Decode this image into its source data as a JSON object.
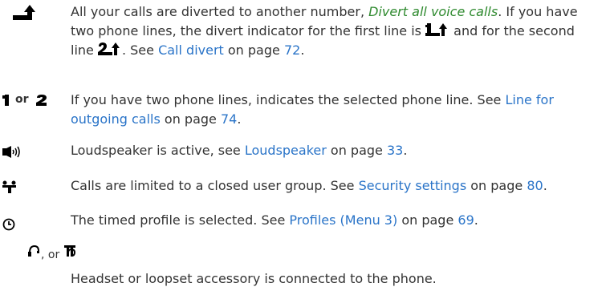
{
  "entries": {
    "divert": {
      "icon": "divert-all-calls-icon",
      "text_before": "All your calls are diverted to another number, ",
      "menu_name": "Divert all voice calls",
      "text_mid": ". If you have two phone lines, the divert indicator for the first line is ",
      "text_and": " and for the second line ",
      "text_see": ". See ",
      "link": "Call divert",
      "text_on_page": " on page ",
      "page": "72",
      "text_end": "."
    },
    "line": {
      "icon_1": "line-1-icon",
      "or_label": "or",
      "icon_2": "line-2-icon",
      "text_before": "If you have two phone lines, indicates the selected phone line. See ",
      "link": "Line for outgoing calls",
      "text_on_page": " on page ",
      "page": "74",
      "text_end": "."
    },
    "loudspeaker": {
      "icon": "loudspeaker-icon",
      "text_before": "Loudspeaker is active, see ",
      "link": "Loudspeaker",
      "text_on_page": " on page ",
      "page": "33",
      "text_end": "."
    },
    "closed_group": {
      "icon": "closed-user-group-icon",
      "text_before": "Calls are limited to a closed user group. See ",
      "link": "Security settings",
      "text_on_page": " on page ",
      "page": "80",
      "text_end": "."
    },
    "timed_profile": {
      "icon": "timed-profile-icon",
      "text_before": "The timed profile is selected. See ",
      "link": "Profiles (Menu 3)",
      "text_on_page": " on page ",
      "page": "69",
      "text_end": "."
    },
    "headset": {
      "icon_1": "headset-icon",
      "or_label": ", or",
      "icon_2": "loopset-icon",
      "text": "Headset or loopset accessory is connected to the phone."
    }
  },
  "colors": {
    "text": "#333333",
    "link": "#2a74c8",
    "menu_name": "#2f8a2f",
    "icon": "#000000"
  }
}
